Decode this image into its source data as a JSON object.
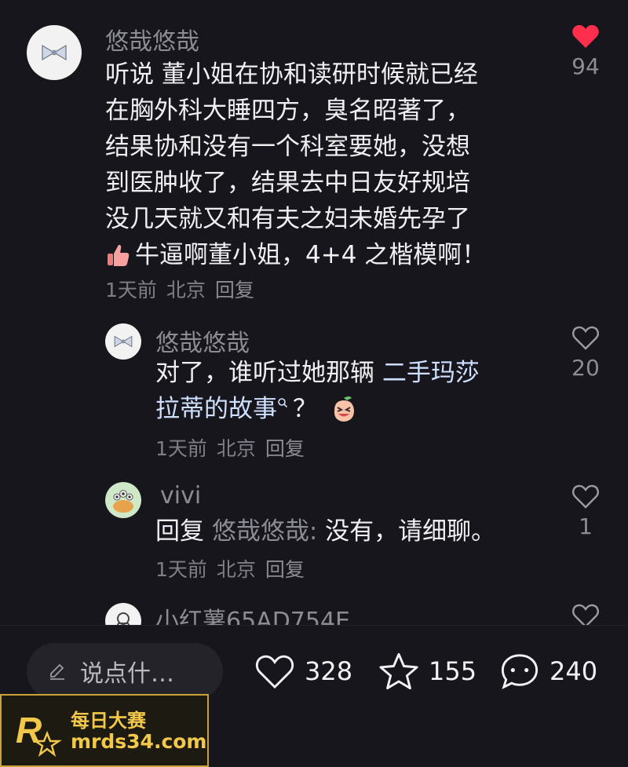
{
  "comments": [
    {
      "author": "悠哉悠哉",
      "lines": [
        "听说 董小姐在协和读研时候就已经",
        "在胸外科大睡四方，臭名昭著了，",
        "结果协和没有一个科室要她，没想",
        "到医肿收了，结果去中日友好规培",
        "没几天就又和有夫之妇未婚先孕了"
      ],
      "last_line": "牛逼啊董小姐，4+4 之楷模啊！",
      "time": "1天前",
      "location": "北京",
      "reply": "回复",
      "likes": "94",
      "liked": true
    },
    {
      "author": "悠哉悠哉",
      "line1_plain": "对了，谁听过她那辆 ",
      "line1_link": "二手玛莎",
      "line2_link": "拉蒂的故事",
      "line2_rest": "？",
      "time": "1天前",
      "location": "北京",
      "reply": "回复",
      "likes": "20"
    },
    {
      "author": "vivi",
      "reply_prefix": "回复",
      "reply_to": "悠哉悠哉:",
      "text": " 没有，请细聊。",
      "time": "1天前",
      "location": "北京",
      "reply": "回复",
      "likes": "1"
    },
    {
      "author": "小红薯65AD754E"
    }
  ],
  "bottom": {
    "input_placeholder": "说点什…",
    "likes": "328",
    "stars": "155",
    "comments": "240"
  },
  "watermark": {
    "title": "每日大赛",
    "url": "mrds34.com",
    "logo_text": "每日大赛"
  },
  "colors": {
    "background": "#17161c",
    "heart_liked": "#ff2e4d",
    "watermark_gold": "#f2c84a"
  }
}
